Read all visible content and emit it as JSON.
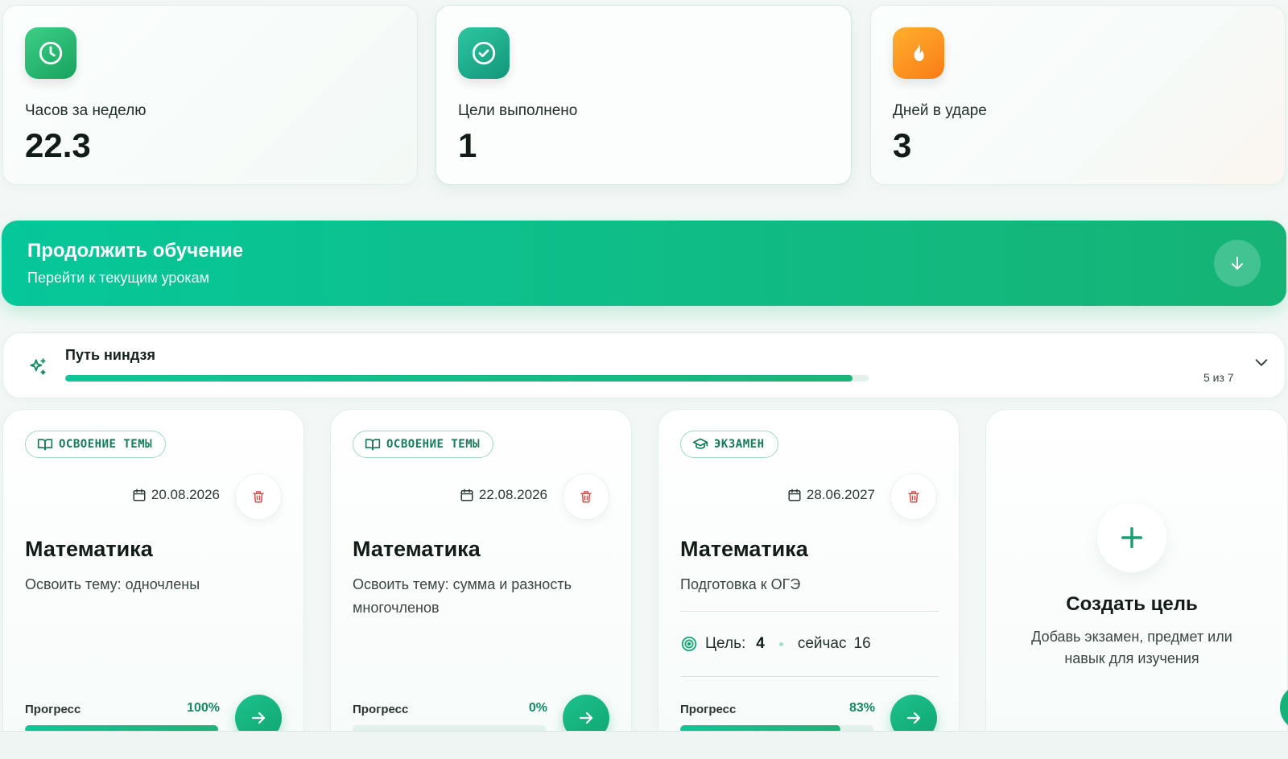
{
  "stats": [
    {
      "label": "Часов за неделю",
      "value": "22.3",
      "icon": "clock-icon",
      "color": "#22b870"
    },
    {
      "label": "Цели выполнено",
      "value": "1",
      "icon": "check-circle-icon",
      "color": "#16a889"
    },
    {
      "label": "Дней в ударе",
      "value": "3",
      "icon": "fire-icon",
      "color": "#fb8c1e"
    }
  ],
  "continue": {
    "title": "Продолжить обучение",
    "subtitle": "Перейти к текущим урокам",
    "icon": "arrow-down-icon"
  },
  "path": {
    "title": "Путь ниндзя",
    "count": "5 из 7",
    "progress": 0.98,
    "icon": "sparkles-icon"
  },
  "goals": [
    {
      "type": "ОСВОЕНИЕ ТЕМЫ",
      "type_icon": "book-icon",
      "date": "20.08.2026",
      "subject": "Математика",
      "description": "Освоить тему: одночлены",
      "progress_label": "Прогресс",
      "progress_pct": "100%",
      "progress": 1.0
    },
    {
      "type": "ОСВОЕНИЕ ТЕМЫ",
      "type_icon": "book-icon",
      "date": "22.08.2026",
      "subject": "Математика",
      "description": "Освоить тему: сумма и разность многочленов",
      "progress_label": "Прогресс",
      "progress_pct": "0%",
      "progress": 0.0
    },
    {
      "type": "ЭКЗАМЕН",
      "type_icon": "graduation-cap-icon",
      "date": "28.06.2027",
      "subject": "Математика",
      "description": "Подготовка к ОГЭ",
      "target_label": "Цель:",
      "target_value": "4",
      "current_label": "сейчас",
      "current_value": "16",
      "progress_label": "Прогресс",
      "progress_pct": "83%",
      "progress": 0.83
    }
  ],
  "create": {
    "title": "Создать цель",
    "description": "Добавь экзамен, предмет или навык для изучения"
  },
  "colors": {
    "accent": "#10bc85",
    "danger": "#e0494b",
    "text": "#15211c"
  }
}
